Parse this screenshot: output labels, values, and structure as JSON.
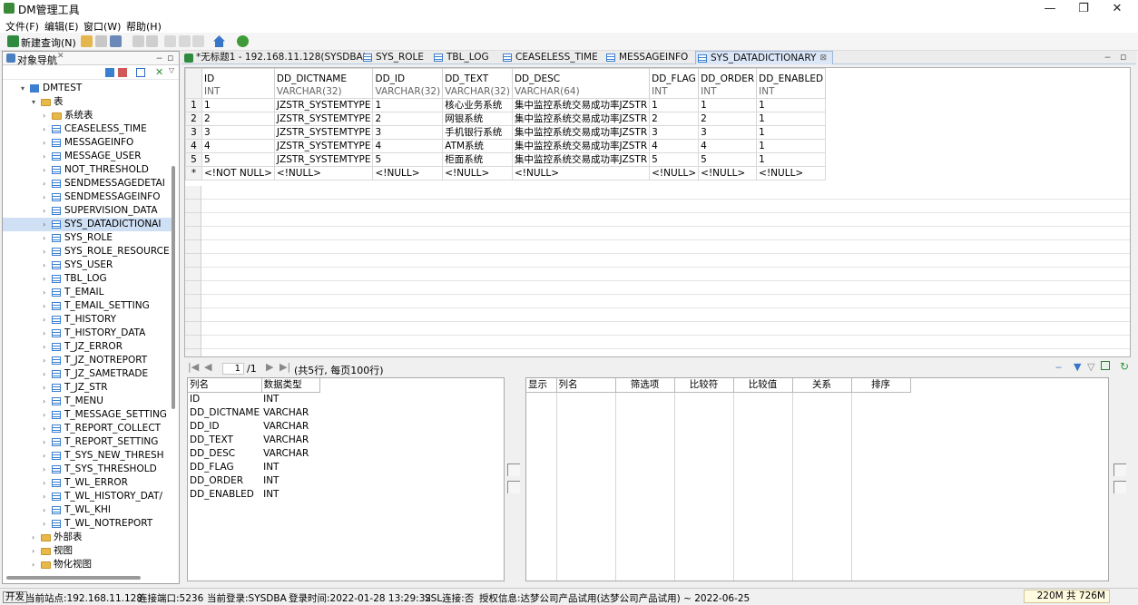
{
  "window": {
    "title": "DM管理工具",
    "min": "—",
    "max": "❐",
    "close": "✕"
  },
  "menus": [
    "文件(F)",
    "编辑(E)",
    "窗口(W)",
    "帮助(H)"
  ],
  "toolbar": {
    "new_query": "新建查询(N)"
  },
  "nav": {
    "title": "对象导航",
    "tree": [
      {
        "label": "DMTEST",
        "kind": "db",
        "indent": 0,
        "twisty": "▾"
      },
      {
        "label": "表",
        "kind": "folder",
        "indent": 1,
        "twisty": "▾"
      },
      {
        "label": "系统表",
        "kind": "folder",
        "indent": 2,
        "twisty": "›"
      },
      {
        "label": "CEASELESS_TIME",
        "kind": "table",
        "indent": 2,
        "twisty": "›"
      },
      {
        "label": "MESSAGEINFO",
        "kind": "table",
        "indent": 2,
        "twisty": "›"
      },
      {
        "label": "MESSAGE_USER",
        "kind": "table",
        "indent": 2,
        "twisty": "›"
      },
      {
        "label": "NOT_THRESHOLD",
        "kind": "table",
        "indent": 2,
        "twisty": "›"
      },
      {
        "label": "SENDMESSAGEDETAI",
        "kind": "table",
        "indent": 2,
        "twisty": "›"
      },
      {
        "label": "SENDMESSAGEINFO",
        "kind": "table",
        "indent": 2,
        "twisty": "›"
      },
      {
        "label": "SUPERVISION_DATA",
        "kind": "table",
        "indent": 2,
        "twisty": "›"
      },
      {
        "label": "SYS_DATADICTIONAI",
        "kind": "table",
        "indent": 2,
        "twisty": "›",
        "selected": true
      },
      {
        "label": "SYS_ROLE",
        "kind": "table",
        "indent": 2,
        "twisty": "›"
      },
      {
        "label": "SYS_ROLE_RESOURCE",
        "kind": "table",
        "indent": 2,
        "twisty": "›"
      },
      {
        "label": "SYS_USER",
        "kind": "table",
        "indent": 2,
        "twisty": "›"
      },
      {
        "label": "TBL_LOG",
        "kind": "table",
        "indent": 2,
        "twisty": "›"
      },
      {
        "label": "T_EMAIL",
        "kind": "table",
        "indent": 2,
        "twisty": "›"
      },
      {
        "label": "T_EMAIL_SETTING",
        "kind": "table",
        "indent": 2,
        "twisty": "›"
      },
      {
        "label": "T_HISTORY",
        "kind": "table",
        "indent": 2,
        "twisty": "›"
      },
      {
        "label": "T_HISTORY_DATA",
        "kind": "table",
        "indent": 2,
        "twisty": "›"
      },
      {
        "label": "T_JZ_ERROR",
        "kind": "table",
        "indent": 2,
        "twisty": "›"
      },
      {
        "label": "T_JZ_NOTREPORT",
        "kind": "table",
        "indent": 2,
        "twisty": "›"
      },
      {
        "label": "T_JZ_SAMETRADE",
        "kind": "table",
        "indent": 2,
        "twisty": "›"
      },
      {
        "label": "T_JZ_STR",
        "kind": "table",
        "indent": 2,
        "twisty": "›"
      },
      {
        "label": "T_MENU",
        "kind": "table",
        "indent": 2,
        "twisty": "›"
      },
      {
        "label": "T_MESSAGE_SETTING",
        "kind": "table",
        "indent": 2,
        "twisty": "›"
      },
      {
        "label": "T_REPORT_COLLECT",
        "kind": "table",
        "indent": 2,
        "twisty": "›"
      },
      {
        "label": "T_REPORT_SETTING",
        "kind": "table",
        "indent": 2,
        "twisty": "›"
      },
      {
        "label": "T_SYS_NEW_THRESH",
        "kind": "table",
        "indent": 2,
        "twisty": "›"
      },
      {
        "label": "T_SYS_THRESHOLD",
        "kind": "table",
        "indent": 2,
        "twisty": "›"
      },
      {
        "label": "T_WL_ERROR",
        "kind": "table",
        "indent": 2,
        "twisty": "›"
      },
      {
        "label": "T_WL_HISTORY_DAT/",
        "kind": "table",
        "indent": 2,
        "twisty": "›"
      },
      {
        "label": "T_WL_KHI",
        "kind": "table",
        "indent": 2,
        "twisty": "›"
      },
      {
        "label": "T_WL_NOTREPORT",
        "kind": "table",
        "indent": 2,
        "twisty": "›"
      },
      {
        "label": "外部表",
        "kind": "folder",
        "indent": 1,
        "twisty": "›"
      },
      {
        "label": "视图",
        "kind": "folder",
        "indent": 1,
        "twisty": "›"
      },
      {
        "label": "物化视图",
        "kind": "folder",
        "indent": 1,
        "twisty": "›"
      }
    ]
  },
  "tabs": [
    {
      "label": "*无标题1 - 192.168.11.128(SYSDBA)",
      "active": false
    },
    {
      "label": "SYS_ROLE",
      "active": false
    },
    {
      "label": "TBL_LOG",
      "active": false
    },
    {
      "label": "CEASELESS_TIME",
      "active": false
    },
    {
      "label": "MESSAGEINFO",
      "active": false
    },
    {
      "label": "SYS_DATADICTIONARY",
      "active": true,
      "close": "⊠"
    }
  ],
  "grid": {
    "columns": [
      {
        "name": "ID",
        "type": "INT"
      },
      {
        "name": "DD_DICTNAME",
        "type": "VARCHAR(32)"
      },
      {
        "name": "DD_ID",
        "type": "VARCHAR(32)"
      },
      {
        "name": "DD_TEXT",
        "type": "VARCHAR(32)"
      },
      {
        "name": "DD_DESC",
        "type": "VARCHAR(64)"
      },
      {
        "name": "DD_FLAG",
        "type": "INT"
      },
      {
        "name": "DD_ORDER",
        "type": "INT"
      },
      {
        "name": "DD_ENABLED",
        "type": "INT"
      }
    ],
    "rows": [
      {
        "num": "1",
        "cells": [
          "1",
          "JZSTR_SYSTEMTYPE",
          "1",
          "核心业务系统",
          "集中监控系统交易成功率JZSTR",
          "1",
          "1",
          "1"
        ]
      },
      {
        "num": "2",
        "cells": [
          "2",
          "JZSTR_SYSTEMTYPE",
          "2",
          "网银系统",
          "集中监控系统交易成功率JZSTR",
          "2",
          "2",
          "1"
        ]
      },
      {
        "num": "3",
        "cells": [
          "3",
          "JZSTR_SYSTEMTYPE",
          "3",
          "手机银行系统",
          "集中监控系统交易成功率JZSTR",
          "3",
          "3",
          "1"
        ]
      },
      {
        "num": "4",
        "cells": [
          "4",
          "JZSTR_SYSTEMTYPE",
          "4",
          "ATM系统",
          "集中监控系统交易成功率JZSTR",
          "4",
          "4",
          "1"
        ]
      },
      {
        "num": "5",
        "cells": [
          "5",
          "JZSTR_SYSTEMTYPE",
          "5",
          "柜面系统",
          "集中监控系统交易成功率JZSTR",
          "5",
          "5",
          "1"
        ]
      },
      {
        "num": "*",
        "cells": [
          "<!NOT NULL>",
          "<!NULL>",
          "<!NULL>",
          "<!NULL>",
          "<!NULL>",
          "<!NULL>",
          "<!NULL>",
          "<!NULL>"
        ]
      }
    ]
  },
  "pager": {
    "page": "1",
    "total": "/1",
    "summary": "(共5行, 每页100行)"
  },
  "columns_panel": {
    "headers": [
      "列名",
      "数据类型"
    ],
    "rows": [
      [
        "ID",
        "INT"
      ],
      [
        "DD_DICTNAME",
        "VARCHAR"
      ],
      [
        "DD_ID",
        "VARCHAR"
      ],
      [
        "DD_TEXT",
        "VARCHAR"
      ],
      [
        "DD_DESC",
        "VARCHAR"
      ],
      [
        "DD_FLAG",
        "INT"
      ],
      [
        "DD_ORDER",
        "INT"
      ],
      [
        "DD_ENABLED",
        "INT"
      ]
    ]
  },
  "filter_panel": {
    "headers": [
      "显示",
      "列名",
      "筛选项",
      "比较符",
      "比较值",
      "关系",
      "排序"
    ]
  },
  "status": {
    "mode": "开发",
    "site": "当前站点:192.168.11.128",
    "port": "连接端口:5236",
    "login": "当前登录:SYSDBA",
    "login_time": "登录时间:2022-01-28 13:29:32",
    "ssl": "SSL连接:否",
    "license": "授权信息:达梦公司产品试用(达梦公司产品试用) ~ 2022-06-25",
    "memory": "220M 共 726M"
  }
}
